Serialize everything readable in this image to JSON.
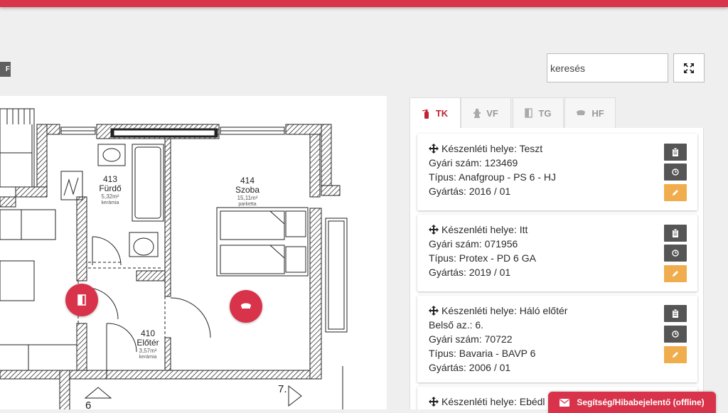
{
  "badge": {
    "label": "F"
  },
  "search": {
    "placeholder": "keresés"
  },
  "colors": {
    "accent": "#d8344a",
    "edit": "#f0ad4e",
    "dark_button": "#555555"
  },
  "tabs": [
    {
      "label": "TK",
      "icon": "fire-extinguisher-icon",
      "active": true
    },
    {
      "label": "VF",
      "icon": "hydrant-icon",
      "active": false
    },
    {
      "label": "TG",
      "icon": "door-icon",
      "active": false
    },
    {
      "label": "HF",
      "icon": "smoke-detector-icon",
      "active": false
    }
  ],
  "floorplan": {
    "rooms": [
      {
        "number": "413",
        "name": "Fürdő",
        "area": "5,32m²",
        "floor": "kerámia"
      },
      {
        "number": "414",
        "name": "Szoba",
        "area": "15,11m²",
        "floor": "parketta"
      },
      {
        "number": "410",
        "name": "Előtér",
        "area": "3,57m²",
        "floor": "kerámia"
      }
    ],
    "labels": {
      "stair_label": "7.",
      "bottom_number": "6"
    },
    "markers": [
      {
        "icon": "door-icon"
      },
      {
        "icon": "smoke-detector-icon"
      }
    ]
  },
  "cards": [
    {
      "lines": [
        "Készenléti helye: Teszt",
        "Gyári szám: 123469",
        "Típus: Anafgroup - PS 6 - HJ",
        "Gyártás: 2016 / 01"
      ]
    },
    {
      "lines": [
        "Készenléti helye: Itt",
        "Gyári szám: 071956",
        "Típus: Protex - PD 6 GA",
        "Gyártás: 2019 / 01"
      ]
    },
    {
      "lines": [
        "Készenléti helye: Háló előtér",
        "Belső az.: 6.",
        "Gyári szám: 70722",
        "Típus: Bavaria - BAVP 6",
        "Gyártás: 2006 / 01"
      ]
    },
    {
      "lines": [
        "Készenléti helye: Ebédl"
      ]
    }
  ],
  "help_button": {
    "label": "Segítség/Hibabejelentő (offline)"
  }
}
